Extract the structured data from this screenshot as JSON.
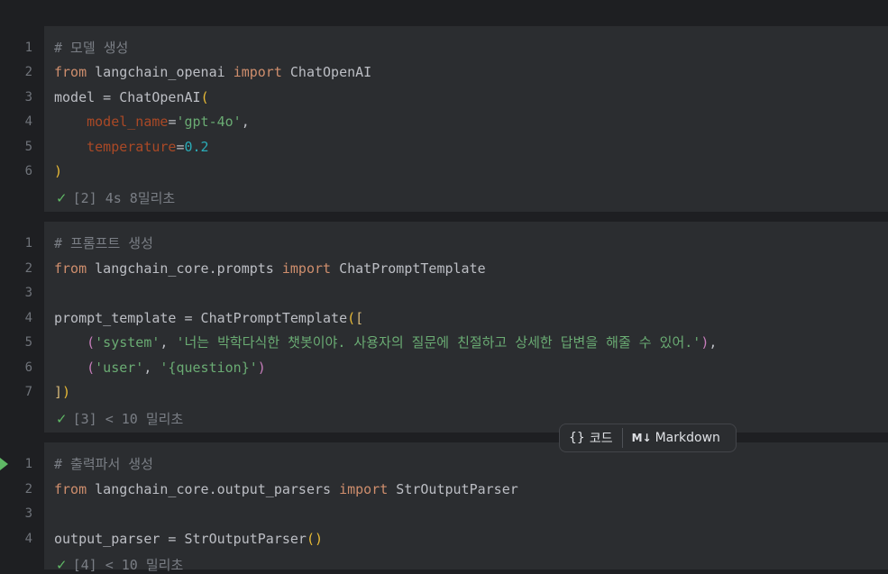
{
  "cells": [
    {
      "lines": [
        "# 모델 생성",
        "from langchain_openai import ChatOpenAI",
        "model = ChatOpenAI(",
        "    model_name='gpt-4o',",
        "    temperature=0.2",
        ")"
      ],
      "status": "[2] 4s 8밀리초"
    },
    {
      "lines": [
        "# 프롬프트 생성",
        "from langchain_core.prompts import ChatPromptTemplate",
        "",
        "prompt_template = ChatPromptTemplate([",
        "    ('system', '너는 박학다식한 챗봇이야. 사용자의 질문에 친절하고 상세한 답변을 해줄 수 있어.'),",
        "    ('user', '{question}')",
        "])"
      ],
      "status": "[3] < 10 밀리초"
    },
    {
      "lines": [
        "# 출력파서 생성",
        "from langchain_core.output_parsers import StrOutputParser",
        "",
        "output_parser = StrOutputParser()"
      ],
      "status": "[4] < 10 밀리초"
    }
  ],
  "popup": {
    "code_icon": "{}",
    "code_label": "코드",
    "md_icon": "M↓",
    "md_label": "Markdown"
  },
  "icons": {
    "check": "check-icon",
    "run": "run-arrow-icon"
  },
  "colors": {
    "keyword": "#cf8e6d",
    "string": "#6aab73",
    "number": "#2aacb8",
    "param": "#aa4926",
    "comment": "#7a7e85",
    "success": "#5fb865"
  }
}
